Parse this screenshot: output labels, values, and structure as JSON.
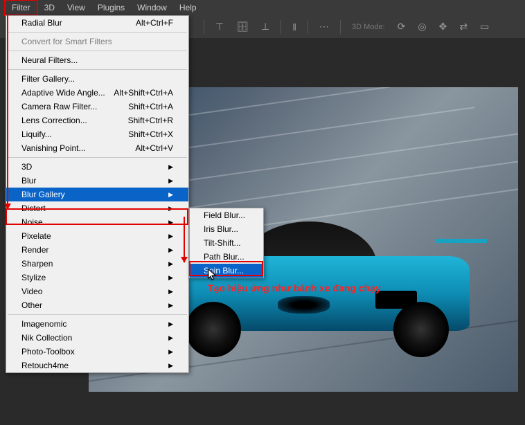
{
  "menubar": {
    "items": [
      "Filter",
      "3D",
      "View",
      "Plugins",
      "Window",
      "Help"
    ],
    "active_index": 0
  },
  "toolbar": {
    "mode_label": "3D Mode:"
  },
  "filter_menu": {
    "recent": {
      "label": "Radial Blur",
      "shortcut": "Alt+Ctrl+F"
    },
    "convert_smart": "Convert for Smart Filters",
    "neural": "Neural Filters...",
    "gallery": "Filter Gallery...",
    "adaptive": {
      "label": "Adaptive Wide Angle...",
      "shortcut": "Alt+Shift+Ctrl+A"
    },
    "camera_raw": {
      "label": "Camera Raw Filter...",
      "shortcut": "Shift+Ctrl+A"
    },
    "lens": {
      "label": "Lens Correction...",
      "shortcut": "Shift+Ctrl+R"
    },
    "liquify": {
      "label": "Liquify...",
      "shortcut": "Shift+Ctrl+X"
    },
    "vanishing": {
      "label": "Vanishing Point...",
      "shortcut": "Alt+Ctrl+V"
    },
    "submenus": {
      "threeD": "3D",
      "blur": "Blur",
      "blur_gallery": "Blur Gallery",
      "distort": "Distort",
      "noise": "Noise",
      "pixelate": "Pixelate",
      "render": "Render",
      "sharpen": "Sharpen",
      "stylize": "Stylize",
      "video": "Video",
      "other": "Other"
    },
    "plugins": {
      "imagenomic": "Imagenomic",
      "nik": "Nik Collection",
      "phototoolbox": "Photo-Toolbox",
      "retouch4me": "Retouch4me"
    }
  },
  "blur_gallery_submenu": {
    "items": [
      "Field Blur...",
      "Iris Blur...",
      "Tilt-Shift...",
      "Path Blur...",
      "Spin Blur..."
    ],
    "highlighted_index": 4
  },
  "annotation_text": "Tạo hiệu ứng như bánh xe đang chạy",
  "colors": {
    "highlight": "#e30000",
    "menu_hover": "#0a64c8"
  }
}
